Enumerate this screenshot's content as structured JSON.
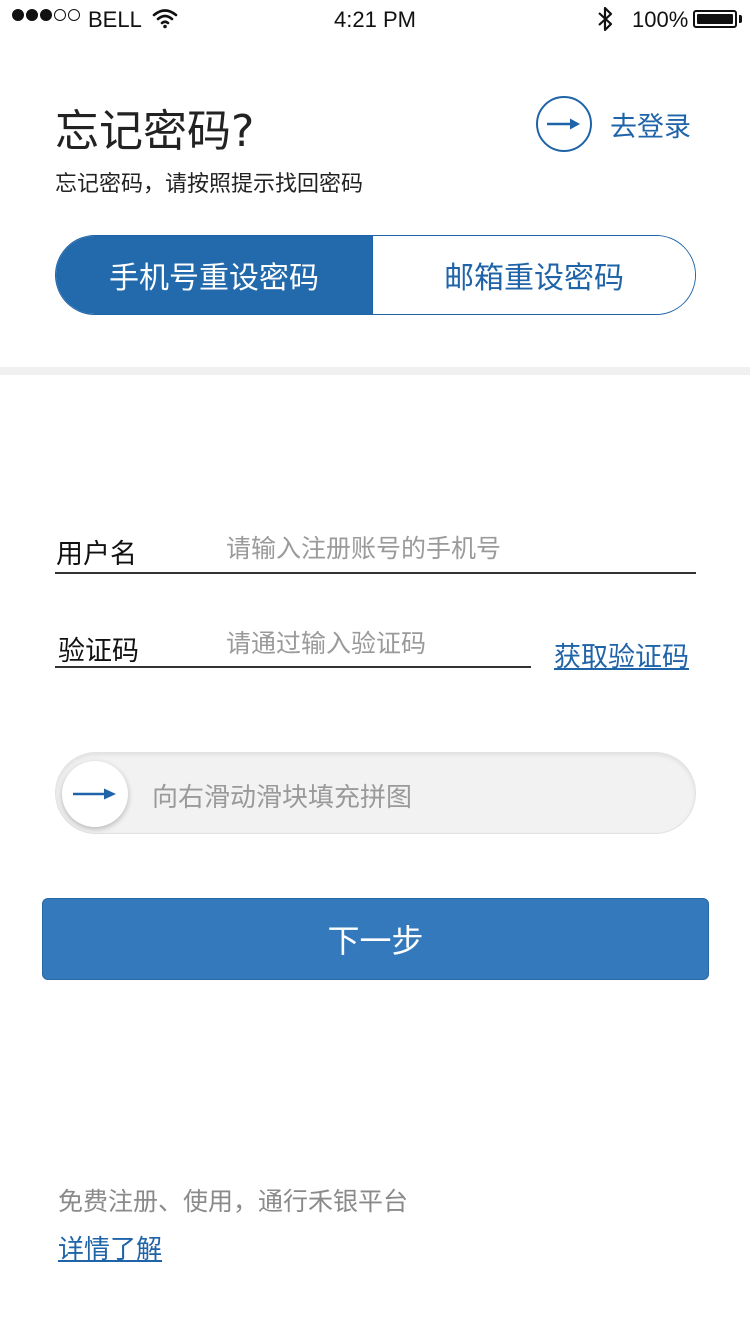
{
  "status_bar": {
    "carrier": "BELL",
    "time": "4:21 PM",
    "battery": "100%",
    "battery_level": 1.0,
    "signal_bars_filled": 3,
    "signal_bars_total": 5
  },
  "header": {
    "title": "忘记密码?",
    "subtitle": "忘记密码，请按照提示找回密码",
    "login_link": "去登录"
  },
  "tabs": [
    {
      "label": "手机号重设密码",
      "active": true
    },
    {
      "label": "邮箱重设密码",
      "active": false
    }
  ],
  "form": {
    "username": {
      "label": "用户名",
      "value": "",
      "placeholder": "请输入注册账号的手机号"
    },
    "code": {
      "label": "验证码",
      "value": "",
      "placeholder": "请通过输入验证码"
    },
    "get_code_link": "获取验证码"
  },
  "slider": {
    "hint": "向右滑动滑块填充拼图",
    "progress": 0
  },
  "next_button": "下一步",
  "footer": {
    "text": "免费注册、使用，通行禾银平台",
    "link": "详情了解"
  },
  "colors": {
    "accent": "#236aad",
    "button": "#3479bb",
    "link": "#1f63a8",
    "muted": "#9a9a9a"
  },
  "icons": [
    "signal-dots-icon",
    "wifi-icon",
    "bluetooth-icon",
    "battery-icon",
    "arrow-right-icon"
  ]
}
